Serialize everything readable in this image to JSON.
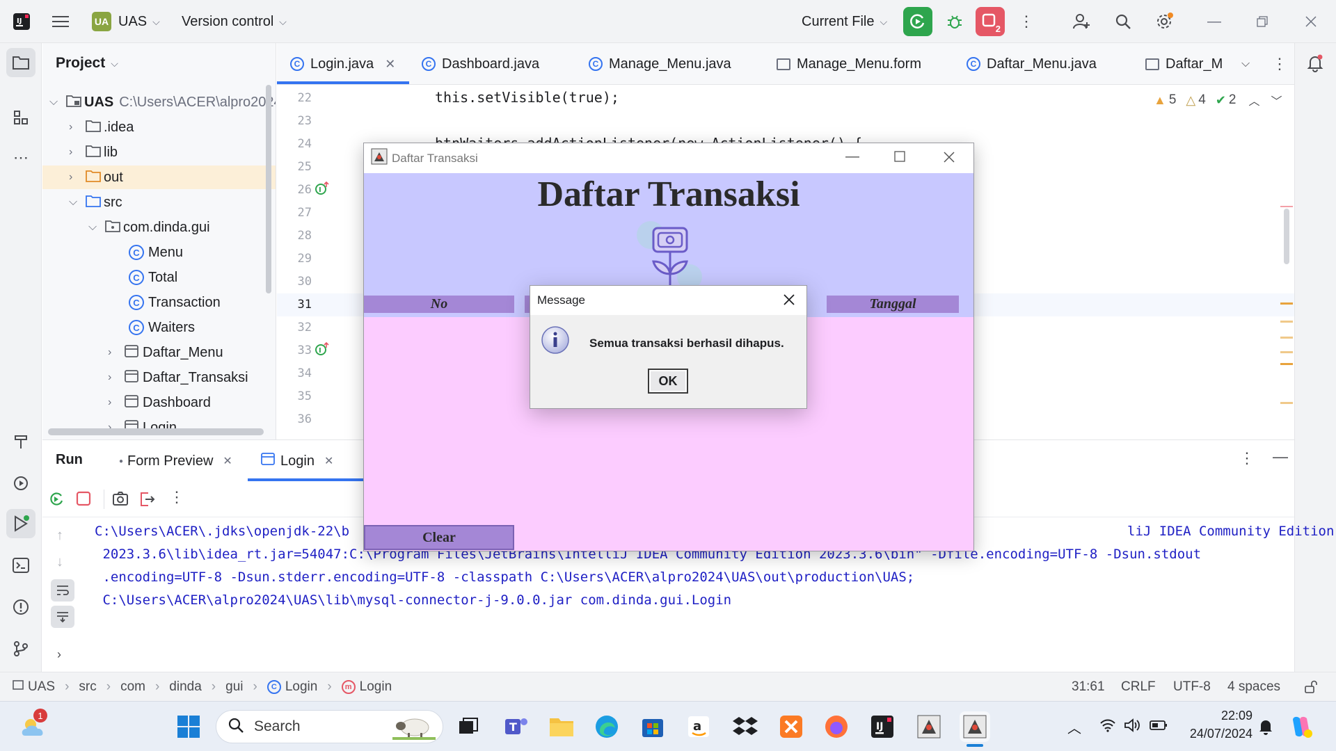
{
  "titlebar": {
    "project_badge": "UA",
    "project_name": "UAS",
    "vcs": "Version control",
    "run_config": "Current File",
    "stop_badge": "2"
  },
  "project_panel": {
    "title": "Project",
    "root_name": "UAS",
    "root_path": "C:\\Users\\ACER\\alpro2024\\UAS",
    "items": [
      {
        "label": ".idea"
      },
      {
        "label": "lib"
      },
      {
        "label": "out"
      },
      {
        "label": "src"
      },
      {
        "label": "com.dinda.gui"
      },
      {
        "label": "Menu"
      },
      {
        "label": "Total"
      },
      {
        "label": "Transaction"
      },
      {
        "label": "Waiters"
      },
      {
        "label": "Daftar_Menu"
      },
      {
        "label": "Daftar_Transaksi"
      },
      {
        "label": "Dashboard"
      },
      {
        "label": "Login"
      }
    ]
  },
  "tabs": [
    {
      "label": "Login.java"
    },
    {
      "label": "Dashboard.java"
    },
    {
      "label": "Manage_Menu.java"
    },
    {
      "label": "Manage_Menu.form"
    },
    {
      "label": "Daftar_Menu.java"
    },
    {
      "label": "Daftar_M"
    }
  ],
  "editor": {
    "line_numbers": [
      "22",
      "23",
      "24",
      "25",
      "26",
      "27",
      "28",
      "29",
      "30",
      "31",
      "32",
      "33",
      "34",
      "35",
      "36"
    ],
    "code_line_22": "this.setVisible(true);",
    "code_line_24": "btnWaiters.addActionListener(new ActionListener() {",
    "inspections": {
      "warnings": "5",
      "weak_warnings": "4",
      "ok": "2"
    }
  },
  "run_panel": {
    "title": "Run",
    "tabs": [
      {
        "label": "Form Preview"
      },
      {
        "label": "Login"
      }
    ],
    "console": [
      "C:\\Users\\ACER\\.jdks\\openjdk-22\\b",
      "liJ IDEA Community Edition",
      " 2023.3.6\\lib\\idea_rt.jar=54047:C:\\Program Files\\JetBrains\\IntelliJ IDEA Community Edition 2023.3.6\\bin\" -Dfile.encoding=UTF-8 -Dsun.stdout",
      " .encoding=UTF-8 -Dsun.stderr.encoding=UTF-8 -classpath C:\\Users\\ACER\\alpro2024\\UAS\\out\\production\\UAS;",
      " C:\\Users\\ACER\\alpro2024\\UAS\\lib\\mysql-connector-j-9.0.0.jar com.dinda.gui.Login"
    ]
  },
  "statusbar": {
    "breadcrumb": [
      "UAS",
      "src",
      "com",
      "dinda",
      "gui",
      "Login",
      "Login"
    ],
    "position": "31:61",
    "line_sep": "CRLF",
    "encoding": "UTF-8",
    "indent": "4 spaces"
  },
  "swing_window": {
    "title": "Daftar Transaksi",
    "heading": "Daftar Transaksi",
    "col_no": "No",
    "col_tanggal": "Tanggal",
    "clear_button": "Clear"
  },
  "dialog": {
    "title": "Message",
    "message": "Semua transaksi berhasil dihapus.",
    "ok": "OK"
  },
  "taskbar": {
    "search_placeholder": "Search",
    "weather_badge": "1",
    "time": "22:09",
    "date": "24/07/2024"
  }
}
